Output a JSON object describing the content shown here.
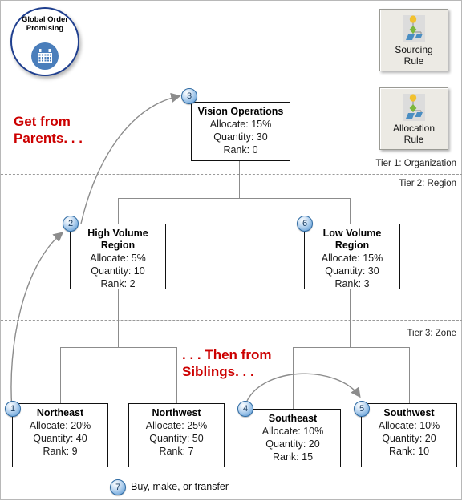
{
  "logo": {
    "line1": "Global Order",
    "line2": "Promising",
    "icon": "calendar-icon"
  },
  "toolbar": {
    "buttons": [
      {
        "id": "sourcing-rule",
        "line1": "Sourcing",
        "line2": "Rule",
        "icon": "hierarchy-icon"
      },
      {
        "id": "allocation-rule",
        "line1": "Allocation",
        "line2": "Rule",
        "icon": "hierarchy-icon"
      }
    ]
  },
  "annotations": {
    "parents": "Get from\nParents. . .",
    "siblings": ". . . Then from\nSiblings. . ."
  },
  "tiers": [
    {
      "label": "Tier 1: Organization"
    },
    {
      "label": "Tier 2: Region"
    },
    {
      "label": "Tier 3: Zone"
    }
  ],
  "legend": {
    "badge": "7",
    "text": "Buy, make, or transfer"
  },
  "labels": {
    "allocate": "Allocate:",
    "quantity": "Quantity:",
    "rank": "Rank:"
  },
  "nodes": [
    {
      "id": "vision-operations",
      "badge": "3",
      "tier": 1,
      "title": "Vision Operations",
      "allocate": "Allocate: 15%",
      "quantity": "Quantity: 30",
      "rank": "Rank: 0",
      "allocate_value": "15%",
      "quantity_value": "30",
      "rank_value": "0"
    },
    {
      "id": "high-volume-region",
      "badge": "2",
      "tier": 2,
      "title": "High Volume Region",
      "title_line1": "High Volume",
      "title_line2": "Region",
      "allocate": "Allocate: 5%",
      "quantity": "Quantity: 10",
      "rank": "Rank: 2",
      "allocate_value": "5%",
      "quantity_value": "10",
      "rank_value": "2"
    },
    {
      "id": "low-volume-region",
      "badge": "6",
      "tier": 2,
      "title": "Low Volume Region",
      "title_line1": "Low Volume",
      "title_line2": "Region",
      "allocate": "Allocate: 15%",
      "quantity": "Quantity: 30",
      "rank": "Rank: 3",
      "allocate_value": "15%",
      "quantity_value": "30",
      "rank_value": "3"
    },
    {
      "id": "northeast",
      "badge": "1",
      "tier": 3,
      "title": "Northeast",
      "allocate": "Allocate: 20%",
      "quantity": "Quantity: 40",
      "rank": "Rank: 9",
      "allocate_value": "20%",
      "quantity_value": "40",
      "rank_value": "9"
    },
    {
      "id": "northwest",
      "badge": "",
      "tier": 3,
      "title": "Northwest",
      "allocate": "Allocate: 25%",
      "quantity": "Quantity: 50",
      "rank": "Rank: 7",
      "allocate_value": "25%",
      "quantity_value": "50",
      "rank_value": "7"
    },
    {
      "id": "southeast",
      "badge": "4",
      "tier": 3,
      "title": "Southeast",
      "allocate": "Allocate: 10%",
      "quantity": "Quantity: 20",
      "rank": "Rank: 15",
      "allocate_value": "10%",
      "quantity_value": "20",
      "rank_value": "15"
    },
    {
      "id": "southwest",
      "badge": "5",
      "tier": 3,
      "title": "Southwest",
      "allocate": "Allocate: 10%",
      "quantity": "Quantity: 20",
      "rank": "Rank: 10",
      "allocate_value": "10%",
      "quantity_value": "20",
      "rank_value": "10"
    }
  ],
  "colors": {
    "annotation_red": "#cc0000",
    "badge_blue": "#4e85bf",
    "logo_border": "#1f3f8f",
    "line_gray": "#8c8c8c"
  }
}
